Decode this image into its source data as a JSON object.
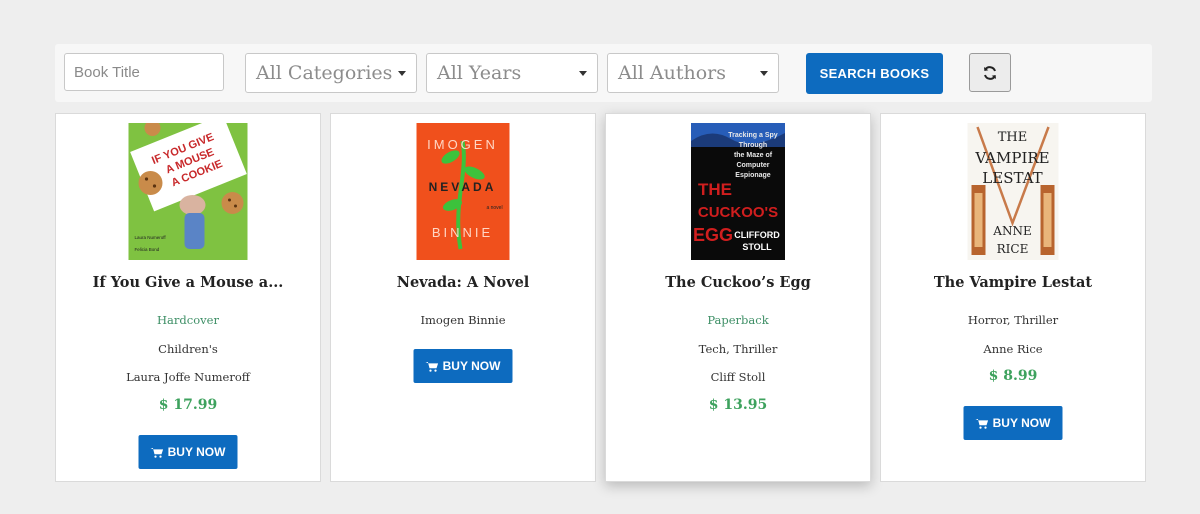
{
  "filters": {
    "title_placeholder": "Book Title",
    "categories_selected": "All Categories",
    "years_selected": "All Years",
    "authors_selected": "All Authors",
    "search_label": "SEARCH BOOKS",
    "reset_icon": "refresh-icon"
  },
  "colors": {
    "accent": "#0d6bbf",
    "price": "#3ea25e",
    "format": "#3e8f66"
  },
  "books": [
    {
      "title": "If You Give a Mouse a...",
      "format": "Hardcover",
      "category": "Children's",
      "author": "Laura Joffe Numeroff",
      "price": "$ 17.99",
      "button": "BUY NOW",
      "cover": {
        "line1": "IF YOU GIVE",
        "line2": "A MOUSE",
        "line3": "A COOKIE",
        "credit1": "Laura Numeroff",
        "credit2": "Felicia Bond"
      }
    },
    {
      "title": "Nevada: A Novel",
      "author": "Imogen Binnie",
      "button": "BUY NOW",
      "cover": {
        "word1": "IMOGEN",
        "word2": "NEVADA",
        "word3": "BINNIE",
        "tag": "a novel"
      }
    },
    {
      "title": "The Cuckoo’s Egg",
      "format": "Paperback",
      "category": "Tech, Thriller",
      "author": "Cliff Stoll",
      "price": "$ 13.95",
      "cover": {
        "sub1": "Tracking a Spy",
        "sub2": "Through",
        "sub3": "the Maze of",
        "sub4": "Computer",
        "sub5": "Espionage",
        "big1": "THE",
        "big2": "CUCKOO'S",
        "big3": "EGG",
        "author1": "CLIFFORD",
        "author2": "STOLL"
      }
    },
    {
      "title": "The Vampire Lestat",
      "category": "Horror, Thriller",
      "author": "Anne Rice",
      "price": "$ 8.99",
      "button": "BUY NOW",
      "cover": {
        "t1": "THE",
        "t2": "VAMPIRE",
        "t3": "LESTAT",
        "a1": "ANNE",
        "a2": "RICE"
      }
    }
  ]
}
